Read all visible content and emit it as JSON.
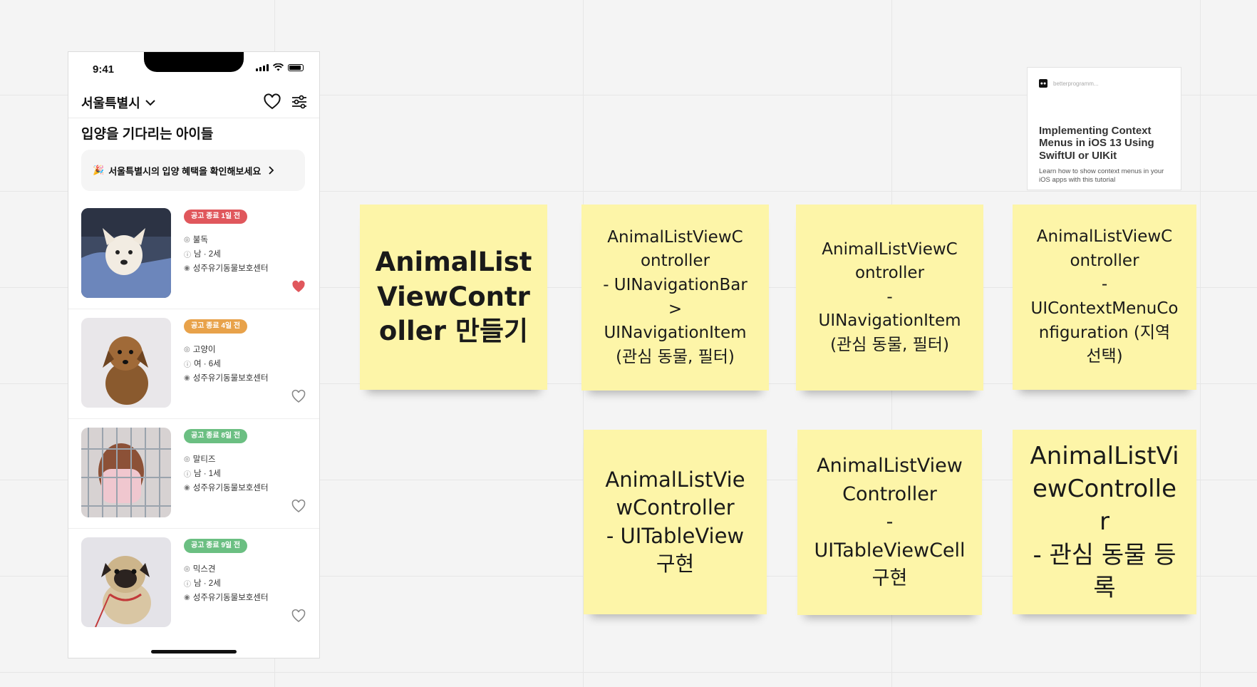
{
  "phone": {
    "status_time": "9:41",
    "region": "서울특별시",
    "page_title": "입양을 기다리는 아이들",
    "banner": {
      "emoji": "🎉",
      "text": "서울특별시의 입양 혜택을 확인해보세요"
    },
    "animals": [
      {
        "badge": "공고 종료 1일 전",
        "badge_color": "#e0575c",
        "breed": "불독",
        "sex_age": "남 · 2세",
        "shelter": "성주유기동물보호센터",
        "favorite": true
      },
      {
        "badge": "공고 종료 4일 전",
        "badge_color": "#e8a24a",
        "breed": "고양이",
        "sex_age": "여 · 6세",
        "shelter": "성주유기동물보호센터",
        "favorite": false
      },
      {
        "badge": "공고 종료 8일 전",
        "badge_color": "#6bbf82",
        "breed": "말티즈",
        "sex_age": "남 · 1세",
        "shelter": "성주유기동물보호센터",
        "favorite": false
      },
      {
        "badge": "공고 종료 9일 전",
        "badge_color": "#6bbf82",
        "breed": "믹스견",
        "sex_age": "남 · 2세",
        "shelter": "성주유기동물보호센터",
        "favorite": false
      }
    ],
    "heart_active_color": "#e0575c"
  },
  "stickies": {
    "s1": "AnimalList\nViewContr\noller 만들기",
    "s2": "AnimalListViewC\nontroller\n- UINavigationBar\n>\nUINavigationItem\n(관심 동물, 필터)",
    "s3": "AnimalListViewC\nontroller\n-\nUINavigationItem\n(관심 동물, 필터)",
    "s4": "AnimalListViewC\nontroller\n-\nUIContextMenuCo\nnfiguration (지역\n선택)",
    "s5": "AnimalListVie\nwController\n- UITableView\n구현",
    "s6": "AnimalListView\nController\n-\nUITableViewCell\n구현",
    "s7": "AnimalListVi\newControlle\nr\n- 관심 동물 등록"
  },
  "link_card": {
    "site": "betterprogramm...",
    "title": "Implementing Context Menus in iOS 13 Using SwiftUI or UIKit",
    "description": "Learn how to show context menus in your iOS apps with this tutorial"
  }
}
